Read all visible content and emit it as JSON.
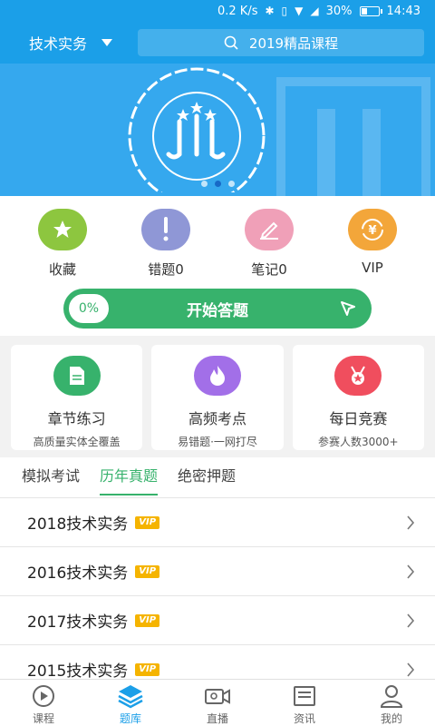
{
  "status_bar": {
    "speed": "0.2 K/s",
    "battery": "30%",
    "battery_level": 0.3,
    "time": "14:43"
  },
  "header": {
    "category": "技术实务",
    "search_placeholder": "2019精品课程"
  },
  "banner": {
    "total_slides": 3,
    "active_slide": 2,
    "logo_icon": "xuejie-education-logo"
  },
  "quick": {
    "items": [
      {
        "label": "收藏",
        "icon": "star-icon",
        "color": "#8dc63f"
      },
      {
        "label": "错题0",
        "icon": "exclamation-icon",
        "color": "#8f97d6"
      },
      {
        "label": "笔记0",
        "icon": "pen-icon",
        "color": "#f0a0b8"
      },
      {
        "label": "VIP",
        "icon": "yen-icon",
        "color": "#f3a63a"
      }
    ],
    "start": {
      "progress": "0%",
      "label": "开始答题"
    }
  },
  "cards": [
    {
      "title": "章节练习",
      "sub": "高质量实体全覆盖",
      "icon": "document-icon",
      "color": "#37b26c"
    },
    {
      "title": "高频考点",
      "sub": "易错题·一网打尽",
      "icon": "fire-icon",
      "color": "#a26fe8"
    },
    {
      "title": "每日竞赛",
      "sub": "参赛人数3000+",
      "icon": "medal-icon",
      "color": "#f04e5e"
    }
  ],
  "tabs": [
    {
      "label": "模拟考试",
      "active": false
    },
    {
      "label": "历年真题",
      "active": true
    },
    {
      "label": "绝密押题",
      "active": false
    }
  ],
  "list": [
    {
      "name": "2018技术实务",
      "badge": "VIP"
    },
    {
      "name": "2016技术实务",
      "badge": "VIP"
    },
    {
      "name": "2017技术实务",
      "badge": "VIP"
    },
    {
      "name": "2015技术实务",
      "badge": "VIP"
    }
  ],
  "nav": [
    {
      "label": "课程",
      "icon": "play-icon",
      "active": false
    },
    {
      "label": "题库",
      "icon": "layers-icon",
      "active": true
    },
    {
      "label": "直播",
      "icon": "video-icon",
      "active": false
    },
    {
      "label": "资讯",
      "icon": "news-icon",
      "active": false
    },
    {
      "label": "我的",
      "icon": "user-icon",
      "active": false
    }
  ]
}
